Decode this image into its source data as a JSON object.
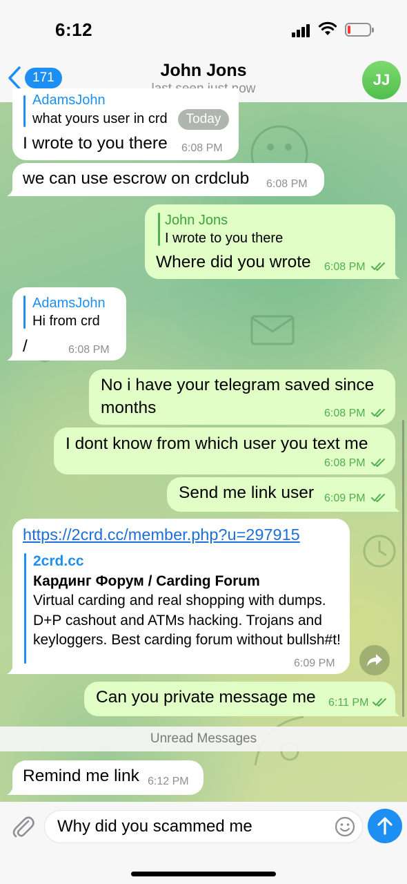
{
  "status_bar": {
    "time": "6:12"
  },
  "header": {
    "back_count": "171",
    "title": "John Jons",
    "subtitle": "last seen just now",
    "avatar_initials": "JJ"
  },
  "date_pill": "Today",
  "messages": [
    {
      "dir": "in",
      "reply_name": "AdamsJohn",
      "reply_text": "what yours user in crd",
      "text": "I wrote to you there",
      "time": "6:08 PM"
    },
    {
      "dir": "in",
      "text": "we can use escrow on crdclub",
      "time": "6:08 PM"
    },
    {
      "dir": "out",
      "reply_name": "John Jons",
      "reply_text": "I wrote to you there",
      "text": "Where did you wrote",
      "time": "6:08 PM"
    },
    {
      "dir": "in",
      "reply_name": "AdamsJohn",
      "reply_text": "Hi from crd",
      "text": "/",
      "time": "6:08 PM"
    },
    {
      "dir": "out",
      "text_line1": "No i have your telegram saved since",
      "text_line2": "months",
      "time": "6:08 PM"
    },
    {
      "dir": "out",
      "text": "I dont know from which user you text me",
      "time": "6:08 PM"
    },
    {
      "dir": "out",
      "text": "Send me link user",
      "time": "6:09 PM"
    },
    {
      "dir": "in",
      "link": "https://2crd.cc/member.php?u=297915",
      "preview_site": "2crd.cc",
      "preview_title": "Кардинг Форум / Carding Forum",
      "preview_desc": "Virtual carding and real shopping with dumps. D+P cashout and ATMs hacking. Trojans and keyloggers. Best carding forum without bullsh#t!",
      "time": "6:09 PM"
    },
    {
      "dir": "out",
      "text": "Can you private message me",
      "time": "6:11 PM"
    },
    {
      "dir": "in",
      "text": "Remind me link",
      "time": "6:12 PM"
    }
  ],
  "unread_label": "Unread Messages",
  "composer": {
    "value": "Why did you scammed me"
  },
  "icons": {
    "back": "chevron-left-icon",
    "attach": "paperclip-icon",
    "emoji": "smiley-icon",
    "send": "arrow-up-icon",
    "share": "share-arrow-icon",
    "read": "double-check-icon"
  },
  "colors": {
    "accent": "#1d8ff2",
    "outgoing_bubble": "#e1fec6",
    "incoming_bubble": "#ffffff",
    "outgoing_meta": "#4fae4e",
    "battery_low": "#ff3b30",
    "avatar": "#5cc85a"
  },
  "battery_level": 0.12
}
